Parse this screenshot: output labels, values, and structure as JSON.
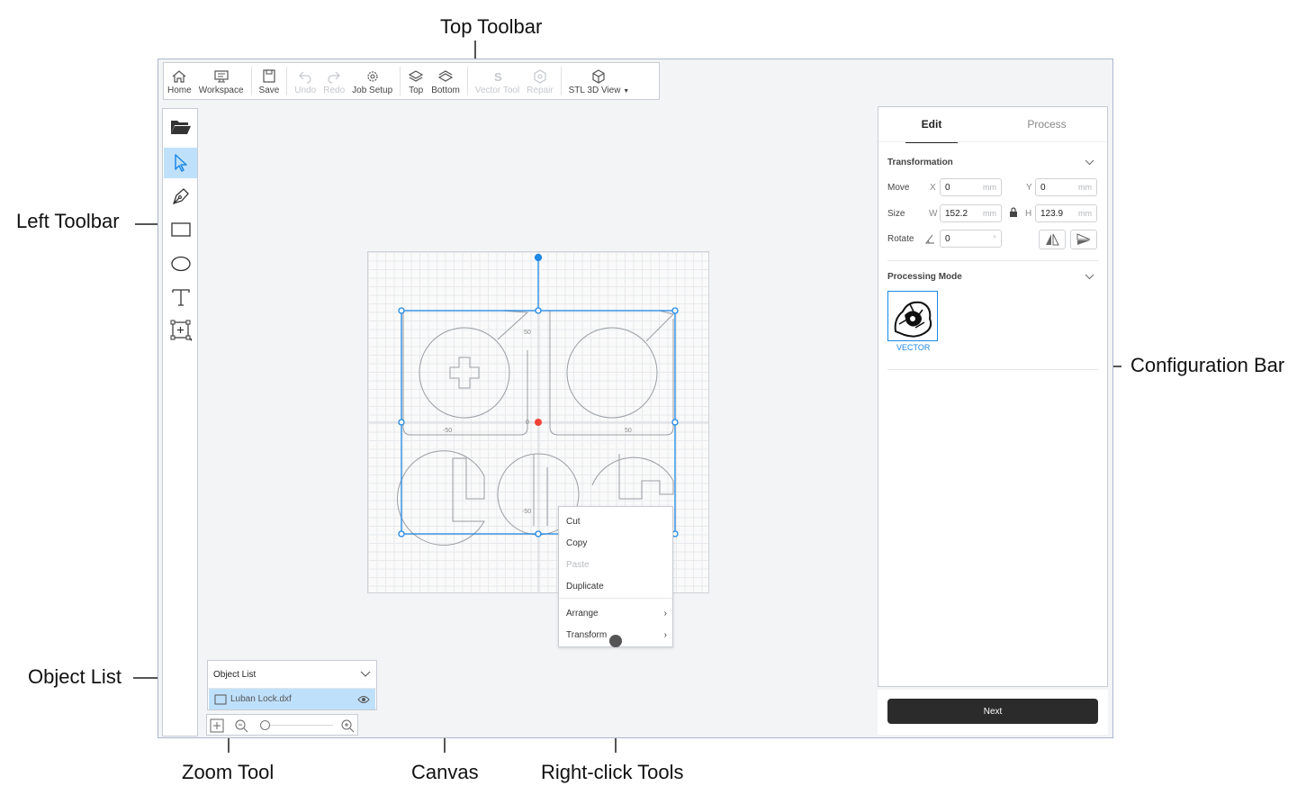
{
  "callouts": {
    "top_toolbar": "Top Toolbar",
    "left_toolbar": "Left Toolbar",
    "configuration_bar": "Configuration Bar",
    "object_list": "Object List",
    "zoom_tool": "Zoom Tool",
    "canvas": "Canvas",
    "right_click_tools": "Right-click Tools"
  },
  "toolbar": {
    "home": "Home",
    "workspace": "Workspace",
    "save": "Save",
    "undo": "Undo",
    "redo": "Redo",
    "job_setup": "Job Setup",
    "top": "Top",
    "bottom": "Bottom",
    "vector_tool": "Vector Tool",
    "repair": "Repair",
    "stl_view": "STL 3D View"
  },
  "canvas": {
    "tick_pos_y": "50",
    "tick_neg_y": "-50",
    "tick_neg_x": "-50",
    "tick_pos_x": "50",
    "origin": "0"
  },
  "context_menu": {
    "cut": "Cut",
    "copy": "Copy",
    "paste": "Paste",
    "duplicate": "Duplicate",
    "arrange": "Arrange",
    "transform": "Transform",
    "submenu_glyph": "›"
  },
  "object_list": {
    "title": "Object List",
    "item": "Luban Lock.dxf"
  },
  "config": {
    "tab_edit": "Edit",
    "tab_process": "Process",
    "transformation": "Transformation",
    "move_label": "Move",
    "x_label": "X",
    "y_label": "Y",
    "move_x": "0",
    "move_y": "0",
    "unit": "mm",
    "size_label": "Size",
    "w_label": "W",
    "h_label": "H",
    "size_w": "152.2",
    "size_h": "123.9",
    "rotate_label": "Rotate",
    "rotate_value": "0",
    "degree_unit": "°",
    "processing_mode": "Processing Mode",
    "mode_name": "VECTOR",
    "next": "Next"
  },
  "colors": {
    "accent": "#1e88e5",
    "active_tool": "#bfe0fb",
    "origin_dot": "#f44336",
    "next_button": "#2b2b2b"
  }
}
